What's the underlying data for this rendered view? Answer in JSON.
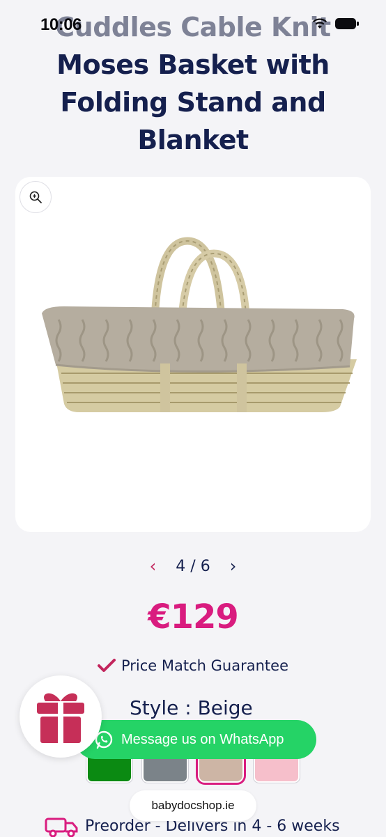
{
  "status_bar": {
    "time": "10:06"
  },
  "product": {
    "title_lines": [
      "Cuddles Cable Knit",
      "Moses Basket with",
      "Folding Stand and",
      "Blanket"
    ],
    "price": "€129",
    "guarantee": "Price Match Guarantee",
    "style_label": "Style : Beige"
  },
  "gallery": {
    "current": "4",
    "separator": "/",
    "total": "6"
  },
  "swatches": [
    {
      "name": "green",
      "color": "#0b8a12"
    },
    {
      "name": "grey",
      "color": "#7b8389"
    },
    {
      "name": "beige",
      "color": "#cdb5a5",
      "selected": true
    },
    {
      "name": "pink",
      "color": "#f6bfcb"
    }
  ],
  "whatsapp": {
    "label": "Message us on WhatsApp"
  },
  "browser": {
    "url": "babydocshop.ie"
  },
  "shipping": {
    "text": "Preorder - Delivers in 4 - 6 weeks"
  },
  "colors": {
    "accent": "#d91c7f",
    "navy": "#15204e",
    "whatsapp": "#25d366"
  }
}
